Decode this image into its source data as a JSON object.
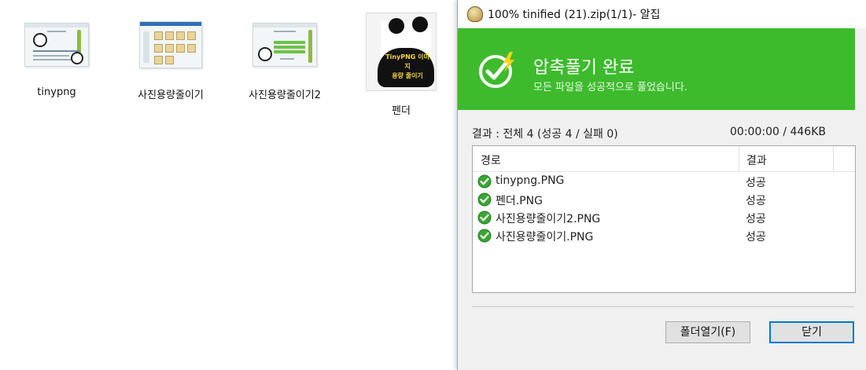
{
  "desktop": {
    "files": [
      {
        "label": "tinypng",
        "icon": "screenshot-thumbnail-icon"
      },
      {
        "label": "사진용량줄이기",
        "icon": "screenshot-thumbnail-icon"
      },
      {
        "label": "사진용량줄이기2",
        "icon": "screenshot-thumbnail-icon"
      },
      {
        "label": "펜더",
        "icon": "panda-image-icon",
        "thumb_text": [
          "TinyPNG 이미지",
          "용량 줄이기"
        ]
      }
    ]
  },
  "dialog": {
    "title": "100% tinified (21).zip(1/1)- 알집",
    "banner": {
      "headline": "압축풀기 완료",
      "subline": "모든 파일을 성공적으로 풀었습니다.",
      "color": "#3dbb2d"
    },
    "summary": "결과 : 전체 4 (성공 4 / 실패 0)",
    "time_size": "00:00:00 / 446KB",
    "columns": {
      "path": "경로",
      "result": "결과"
    },
    "rows": [
      {
        "name": "tinypng.PNG",
        "status": "성공"
      },
      {
        "name": "펜더.PNG",
        "status": "성공"
      },
      {
        "name": "사진용량줄이기2.PNG",
        "status": "성공"
      },
      {
        "name": "사진용량줄이기.PNG",
        "status": "성공"
      }
    ],
    "buttons": {
      "open_folder": "폴더열기(F)",
      "close": "닫기"
    }
  }
}
